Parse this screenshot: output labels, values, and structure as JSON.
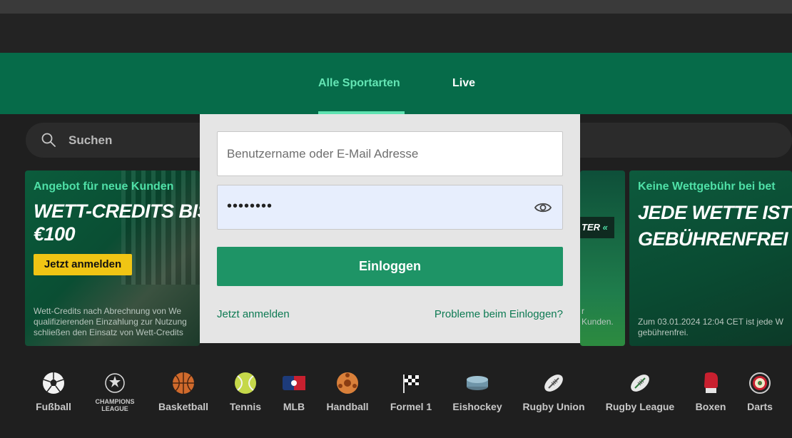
{
  "nav": {
    "tabs": [
      {
        "label": "Alle Sportarten",
        "active": true
      },
      {
        "label": "Live",
        "active": false
      }
    ]
  },
  "search": {
    "placeholder": "Suchen",
    "icon": "search-icon"
  },
  "promos": [
    {
      "headline": "Angebot für neue Kunden",
      "title_line1": "WETT-CREDITS BIS ZU",
      "title_line2": "€100",
      "button": "Jetzt anmelden",
      "fine_lines": [
        "Wett-Credits nach Abrechnung von We",
        "qualifizierenden Einzahlung zur Nutzung",
        "schließen den Einsatz von Wett-Credits"
      ]
    },
    {
      "badge": "TER",
      "fine_lines": [
        "r",
        "Kunden."
      ]
    },
    {
      "headline": "Keine Wettgebühr bei bet",
      "title_line1": "JEDE WETTE IST",
      "title_line2": "GEBÜHRENFREI",
      "fine_lines": [
        "Zum 03.01.2024 12:04 CET ist jede W",
        "gebührenfrei."
      ]
    }
  ],
  "login": {
    "username_placeholder": "Benutzername oder E-Mail Adresse",
    "password_masked": "••••••••",
    "submit": "Einloggen",
    "register_link": "Jetzt anmelden",
    "problem_link": "Probleme beim Einloggen?"
  },
  "sports": [
    {
      "label": "Fußball",
      "icon": "soccer-ball-icon"
    },
    {
      "label": "CHAMPIONS LEAGUE",
      "icon": "champions-league-icon"
    },
    {
      "label": "Basketball",
      "icon": "basketball-icon"
    },
    {
      "label": "Tennis",
      "icon": "tennis-ball-icon"
    },
    {
      "label": "MLB",
      "icon": "mlb-icon"
    },
    {
      "label": "Handball",
      "icon": "handball-icon"
    },
    {
      "label": "Formel 1",
      "icon": "checkered-flag-icon"
    },
    {
      "label": "Eishockey",
      "icon": "hockey-puck-icon"
    },
    {
      "label": "Rugby Union",
      "icon": "rugby-ball-icon"
    },
    {
      "label": "Rugby League",
      "icon": "rugby-ball-icon"
    },
    {
      "label": "Boxen",
      "icon": "boxing-glove-icon"
    },
    {
      "label": "Darts",
      "icon": "dartboard-icon"
    }
  ],
  "colors": {
    "brand_green": "#066b49",
    "active_tab": "#64e5b4",
    "login_button": "#1e9466",
    "promo_button": "#f0c514"
  }
}
